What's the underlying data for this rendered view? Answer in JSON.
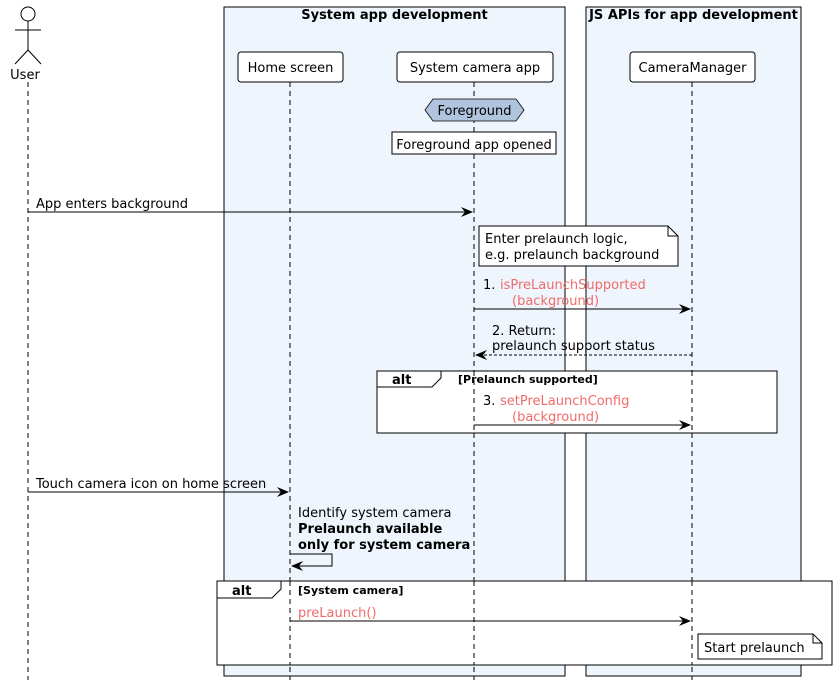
{
  "actor": {
    "label": "User"
  },
  "boxes": [
    {
      "title": "System app development"
    },
    {
      "title": "JS APIs for app development"
    }
  ],
  "participants": [
    {
      "label": "Home screen"
    },
    {
      "label": "System camera app"
    },
    {
      "label": "CameraManager"
    }
  ],
  "state": {
    "label": "Foreground",
    "color": "#b0c4de"
  },
  "notes": {
    "foreground_opened": "Foreground app opened",
    "prelaunch_logic_1": "Enter prelaunch logic,",
    "prelaunch_logic_2": "e.g. prelaunch background",
    "start_prelaunch": "Start prelaunch"
  },
  "messages": {
    "app_bg": "App enters background",
    "m1_num": "1.",
    "m1_call": "isPreLaunchSupported",
    "m1_arg": "(background)",
    "m2_line1": "2. Return:",
    "m2_line2": "prelaunch support status",
    "m3_num": "3.",
    "m3_call": "setPreLaunchConfig",
    "m3_arg": "(background)",
    "touch": "Touch camera icon on home screen",
    "identify": "Identify system camera",
    "avail1": "Prelaunch available",
    "avail2": "only for system camera",
    "prelaunch": "preLaunch()"
  },
  "fragments": [
    {
      "op": "alt",
      "guard": "[Prelaunch supported]"
    },
    {
      "op": "alt",
      "guard": "[System camera]"
    }
  ],
  "colors": {
    "box_fill": "#eef5fd",
    "api_call": "#f06b6b"
  }
}
